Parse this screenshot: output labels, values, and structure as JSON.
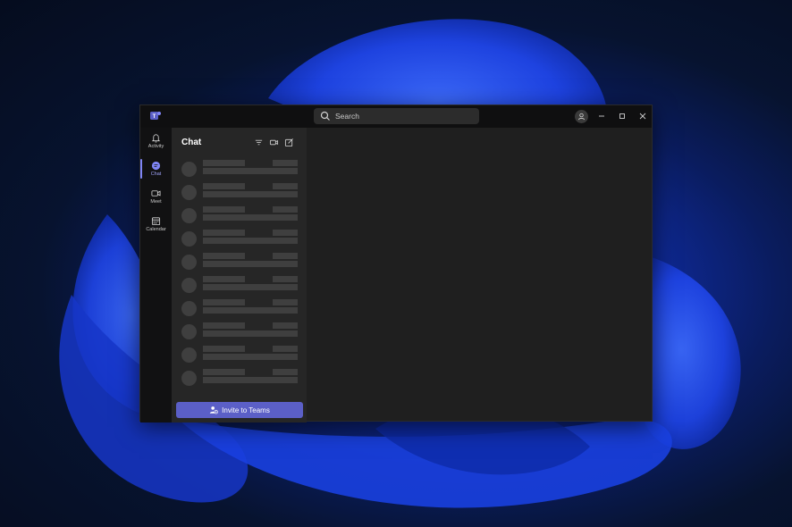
{
  "window": {
    "search_placeholder": "Search"
  },
  "rail": {
    "items": [
      {
        "label": "Activity",
        "icon": "bell-icon"
      },
      {
        "label": "Chat",
        "icon": "chat-icon"
      },
      {
        "label": "Meet",
        "icon": "video-icon"
      },
      {
        "label": "Calendar",
        "icon": "calendar-icon"
      }
    ],
    "active_color": "#7f85f5"
  },
  "chat_panel": {
    "title": "Chat",
    "header_icons": [
      "filter-icon",
      "meet-now-icon",
      "new-chat-icon"
    ],
    "skeleton_rows": 10,
    "invite_label": "Invite to Teams",
    "invite_color": "#5b5fc7"
  },
  "colors": {
    "titlebar": "#0f0f10",
    "rail": "#111112",
    "panel": "#262626",
    "main": "#1f1f1f",
    "skeleton": "#3f3f3f"
  }
}
